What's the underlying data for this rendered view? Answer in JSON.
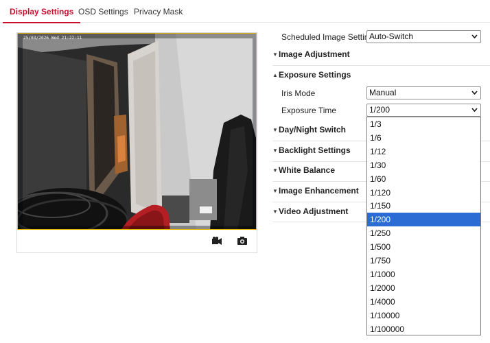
{
  "tabs": [
    {
      "label": "Display Settings",
      "active": true
    },
    {
      "label": "OSD Settings",
      "active": false
    },
    {
      "label": "Privacy Mask",
      "active": false
    }
  ],
  "preview": {
    "osd_timestamp": "25/03/2026 Wed 21:22:11",
    "record_icon": "record-video-icon",
    "snapshot_icon": "camera-icon"
  },
  "settings": {
    "scheduled_label": "Scheduled Image Settings",
    "scheduled_value": "Auto-Switch",
    "sections": {
      "image_adjustment": "Image Adjustment",
      "exposure_settings": "Exposure Settings",
      "day_night_switch": "Day/Night Switch",
      "backlight_settings": "Backlight Settings",
      "white_balance": "White Balance",
      "image_enhancement": "Image Enhancement",
      "video_adjustment": "Video Adjustment"
    },
    "iris_mode_label": "Iris Mode",
    "iris_mode_value": "Manual",
    "exposure_time_label": "Exposure Time",
    "exposure_time_value": "1/200"
  },
  "exposure_options": [
    "1/3",
    "1/6",
    "1/12",
    "1/30",
    "1/60",
    "1/120",
    "1/150",
    "1/200",
    "1/250",
    "1/500",
    "1/750",
    "1/1000",
    "1/2000",
    "1/4000",
    "1/10000",
    "1/100000"
  ],
  "selected_option_index": 7,
  "colors": {
    "accent": "#c8102e",
    "selection": "#2b6cd4",
    "preview_border": "#e8b600"
  }
}
